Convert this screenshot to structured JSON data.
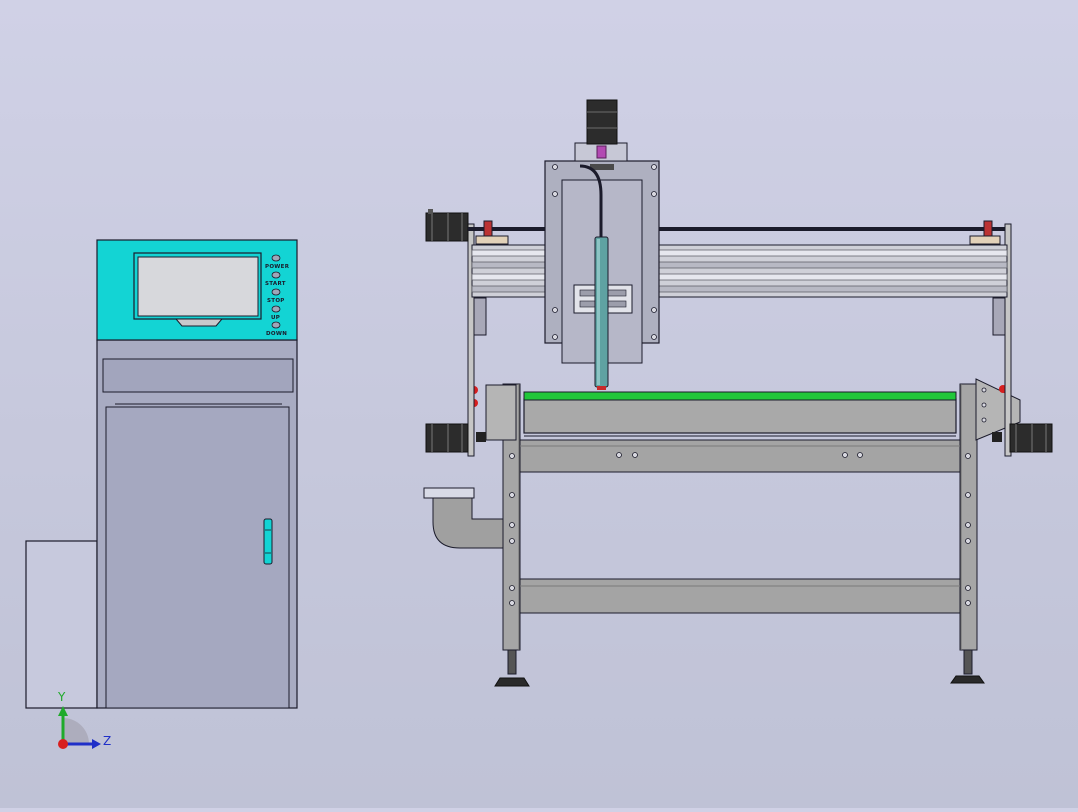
{
  "control_panel": {
    "buttons": [
      {
        "label": "POWER"
      },
      {
        "label": "START"
      },
      {
        "label": "STOP"
      },
      {
        "label": "UP"
      },
      {
        "label": "DOWN"
      }
    ]
  },
  "triad": {
    "y_label": "Y",
    "z_label": "Z"
  },
  "colors": {
    "background": "#cbcde2",
    "cabinet_top": "#13d4d4",
    "cabinet_body": "#a8abc2",
    "bed_surface": "#21c73a",
    "frame_steel": "#aaaaaa",
    "axis_y": "#1faa2a",
    "axis_z": "#1f2fc8",
    "axis_x": "#d81f1f"
  }
}
